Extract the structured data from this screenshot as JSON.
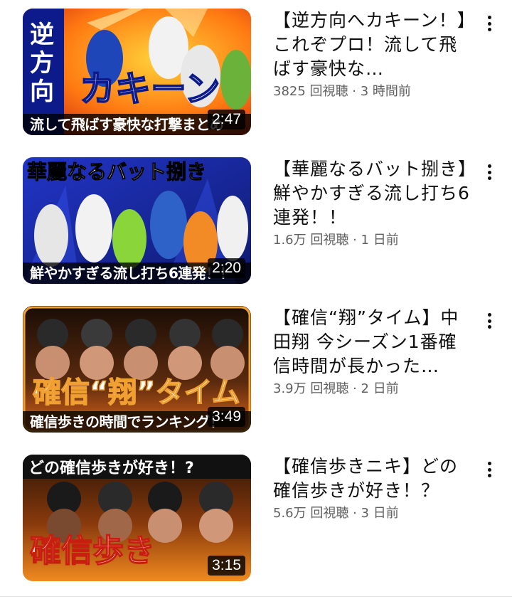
{
  "videos": [
    {
      "title": "【逆方向へカキーン！】これぞプロ！流して飛ばす豪快な…",
      "views": "3825 回視聴",
      "separator": " · ",
      "age": "3 時間前",
      "duration": "2:47",
      "thumb_caption": "流して飛ばす豪快な打撃まとめ",
      "thumb_colors": [
        "#c81e10",
        "#f5a400"
      ]
    },
    {
      "title": "【華麗なるバット捌き】鮮やかすぎる流し打ち6連発！！",
      "views": "1.6万 回視聴",
      "separator": " · ",
      "age": "1 日前",
      "duration": "2:20",
      "thumb_caption": "鮮やかすぎる流し打ち6連発！！",
      "thumb_colors": [
        "#1a2a9c",
        "#3d4fd6"
      ]
    },
    {
      "title": "【確信“翔”タイム】中田翔 今シーズン1番確信時間が長かった…",
      "views": "3.9万 回視聴",
      "separator": " · ",
      "age": "2 日前",
      "duration": "3:49",
      "thumb_caption": "確信歩きの時間でランキング！",
      "thumb_colors": [
        "#1a0d06",
        "#e0661a"
      ]
    },
    {
      "title": "【確信歩きニキ】どの確信歩きが好き！？",
      "views": "5.6万 回視聴",
      "separator": " · ",
      "age": "3 日前",
      "duration": "3:15",
      "thumb_caption": "どの確信歩きが好き！?",
      "thumb_colors": [
        "#2a1408",
        "#f08a20"
      ]
    }
  ],
  "icons": {
    "more": "more-vert-icon"
  }
}
